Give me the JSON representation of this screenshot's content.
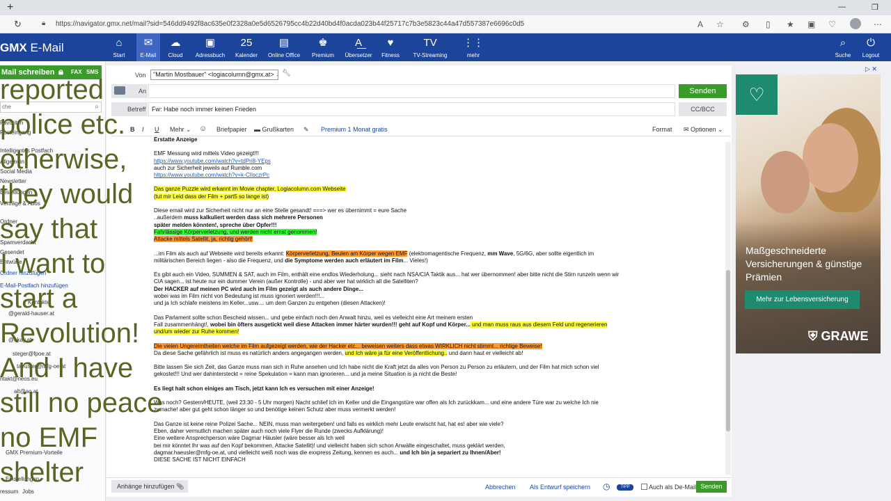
{
  "browser": {
    "url": "https://navigator.gmx.net/mail?sid=546dd9492f8ac635e0f2328a0e5d6526795cc4b22d40bd4f0acda023b44f25717c7b3e5823c44a47d557387e6696c0d5"
  },
  "brand": {
    "name": "GMX",
    "suffix": "E-Mail"
  },
  "topnav": [
    {
      "label": "Start",
      "icon": "home-icon",
      "glyph": "⌂"
    },
    {
      "label": "E-Mail",
      "icon": "mail-icon",
      "glyph": "✉"
    },
    {
      "label": "Cloud",
      "icon": "cloud-icon",
      "glyph": "☁"
    },
    {
      "label": "Adressbuch",
      "icon": "addressbook-icon",
      "glyph": "▣"
    },
    {
      "label": "Kalender",
      "icon": "calendar-icon",
      "glyph": "25"
    },
    {
      "label": "Online Office",
      "icon": "office-icon",
      "glyph": "▤"
    },
    {
      "label": "Premium",
      "icon": "premium-icon",
      "glyph": "♚"
    },
    {
      "label": "Übersetzer",
      "icon": "translate-icon",
      "glyph": "A͟"
    },
    {
      "label": "Fitness",
      "icon": "fitness-icon",
      "glyph": "♥"
    },
    {
      "label": "TV-Streaming",
      "icon": "tv-icon",
      "glyph": "TV"
    },
    {
      "label": "mehr",
      "icon": "more-grid-icon",
      "glyph": "⋮⋮"
    },
    {
      "label": "Suche",
      "icon": "search-icon",
      "glyph": "⌕"
    },
    {
      "label": "Logout",
      "icon": "power-icon",
      "glyph": "⏻"
    }
  ],
  "sidebar": {
    "compose_label": "Mail schreiben",
    "fax": "FAX",
    "sms": "SMS",
    "search_placeholder": "che",
    "items": [
      "Favoriten",
      "Posteingang",
      "Intelligentes Postfach",
      "Allgemein",
      "Social Media",
      "Newsletter",
      "Bestellungen",
      "Verträge & Abos",
      "Ordner",
      "Spamverdacht",
      "Gesendet",
      "Entwürfe",
      "Ordner hinzufügen",
      "E-Mail-Postfach hinzufügen",
      "Kontakte",
      "@gerald-hauser.at",
      "@okay.at",
      "steger@fpoe.at",
      "taeusler@mfg-oe.at",
      "ntakt@neos.eu",
      "alt@ao.at"
    ],
    "premium": "GMX Premium-Vorteile",
    "settings": "Einstellungen",
    "footer_imprint": "ressum",
    "footer_jobs": "Jobs"
  },
  "overlay_lines": [
    "reported",
    "police etc.",
    "otherwise,",
    "they would",
    "say that",
    "I want to",
    "start a",
    "Revolution!",
    "And I have",
    "still no peace",
    "no EMF",
    "shelter"
  ],
  "compose": {
    "from_label": "Von",
    "from_value": "\"Martin Mostbauer\" <logiacolumn@gmx.at>",
    "to_label": "An",
    "to_value": "",
    "subject_label": "Betreff",
    "subject_value": "Fw: Habe noch immer keinen Frieden",
    "send_label": "Senden",
    "ccbcc_label": "CC/BCC"
  },
  "toolbar": {
    "bold": "B",
    "italic": "I",
    "underline": "U",
    "more": "Mehr ⌄",
    "emoji": "☺",
    "letterpaper": "Briefpapier",
    "cards": "Grußkarten",
    "premium": "Premium 1 Monat gratis",
    "format": "Format",
    "options": "Optionen ⌄"
  },
  "body": {
    "l01": "Erstatte Anzeige",
    "l02": "EMF Messung wird mittels Video gezeigt!!!",
    "l03": "https://www.youtube.com/watch?v=tdPri8-YEps",
    "l04": "auch zur Sicherheit jeweils auf Rumble.com",
    "l05": "https://www.youtube.com/watch?v=k-CIIsczrPc",
    "l06": "Das ganze Puzzle wird erkannt im Movie chapter, Logiacolumn.com Webseite",
    "l07": "(tut mir Leid dass der Film + part5 so lange ist)",
    "l08": "Diese email wird zur Sicherheit nicht nur an eine Stelle gesandt! ===> wer es übernimmt = eure Sache",
    "l09a": "..außerdem ",
    "l09b": "muss kalkuliert werden dass sich mehrere Personen",
    "l10": "später melden könnten!, spreche über Opfer!!!",
    "l11": "Fahrlässige Körperverletzung, und werden nicht ernst genommen!",
    "l12": "Attacke mittels Satellit, ja, richtig gehört!",
    "l13a": "...im Film als auch auf Webseite wird bereits erkannt: ",
    "l13b": "Körperverletzung, Beulen am Körper wegen EMF",
    "l13c": " (elektromagentische Frequenz, ",
    "l13d": "mm Wave",
    "l13e": ", 5G/6G, aber sollte eigentlich im",
    "l14a": "militärischen Bereich liegen - also die Frequenz, und ",
    "l14b": "die Symptome werden auch erläutert im Film",
    "l14c": "... Vieles!)",
    "l15": "Es gibt auch ein Video, SUMMEN & SAT, auch im Film, enthält eine endlos Wiederholung... sieht nach NSA/CIA Taktik aus... hat wer übernommen! aber bitte nicht die Stirn runzeln wenn wir",
    "l16": "CIA sagen... ist heute nur ein dummer Verein (außer Kontrolle) - und aber wer hat wirklich all die Satelliten?",
    "l17": "Der HACKER auf meinen PC wird auch im Film gezeigt als auch andere Dinge...",
    "l18": "wobei was im Film nicht von Bedeutung ist muss ignoriert werden!!!...",
    "l19": "und ja Ich schlafe meistens im Keller...usw.... um dem Ganzen zu entgehen (diesen Attacken)!",
    "l20": "Das Parlament sollte schon Bescheid wissen... und gebe einfach noch den Anwalt hinzu, weil es vielleicht eine Art meinem ersten",
    "l21a": "Fall zusammenhängt!, ",
    "l21b": "wobei bin öfters ausgetickt weil diese Attacken immer härter wurden!!! geht auf Kopf und Körper...",
    "l21c": " und man muss raus aus diesem Feld und regenerieren",
    "l22": "und/um wieder zur Ruhe kommen!",
    "l23": "Die vielen Ungereimtheiten welche im Film aufgezeigt werden, wie der Hacker etc... beweisen weiters dass etwas WIRKLICH nicht stimmt... richtige Beweise!",
    "l24a": "Da diese Sache gefährlich ist muss es natürlich anders angegangen werden, ",
    "l24b": "und Ich wäre ja für eine Veröffentlichung..",
    "l24c": " und dann haut er vielleicht ab!",
    "l25": "Bitte lassen Sie sich Zeit, das Ganze muss man sich in Ruhe ansehen und Ich habe nicht die Kraft jetzt da alles von Person zu Person zu erläutern, und der Film hat mich schon viel",
    "l26": "gekostet!!! Und wer dahintersteckt = reine Spekulation = kann man ignorieren... und ja meine Situation is ja nicht die Beste!",
    "l27": "Es liegt halt schon einiges am Tisch, jetzt kann Ich es versuchen mit einer Anzeige!",
    "l28": "Was noch? Gestern/HEUTE, (weil 23:30 - 5 Uhr morgen) Nacht schlief Ich im Keller und die Eingangstüre war offen als Ich zurückkam... und eine andere Türe war zu welche Ich nie",
    "l29": "zumache! aber gut geht schon länger so und benötige keinen Schutz aber muss vermerkt werden!",
    "l30": "Das Ganze ist keine reine Polizei Sache... NEIN, muss man weitergeben! und falls es wirklich mehr Leute erwischt hat, hat es! aber wie viele?",
    "l31": "Eben, daher vermutlich machen später auch noch viele Flyer die Runde (zwecks Aufklärung)!",
    "l32": "Eine weitere Ansprechperson wäre Dagmar Häusler (wäre besser als Ich weil",
    "l33": "bei mir könntet Ihr was auf den Kopf bekommen, Attacke Satellit)! und vielleicht haben sich schon Anwälte eingeschaltet, muss geklärt werden,",
    "l34a": "dagmar.haeusler@mfg-oe.at, und vielleicht weiß noch was die exxpress Zeitung, kennen es auch... ",
    "l34b": "und Ich bin ja separiert zu Ihnen/Aber!",
    "l35": "DIESE SACHE IST NICHT EINFACH"
  },
  "bottombar": {
    "attach": "Anhänge hinzufügen",
    "cancel": "Abbrechen",
    "draft": "Als Entwurf speichern",
    "tipp": "TIPP",
    "demail": "Auch als De-Mail",
    "send": "Senden"
  },
  "ad": {
    "text": "Maßgeschneiderte Versicherungen & günstige Prämien",
    "button": "Mehr zur Lebensversicherung",
    "logo": "GRAWE",
    "choices": "▷ ✕"
  },
  "colors": {
    "gmx_blue": "#1c449b",
    "send_green": "#3b9b2a",
    "ad_green": "#1e8a6e",
    "overlay_text": "#5b6421"
  }
}
